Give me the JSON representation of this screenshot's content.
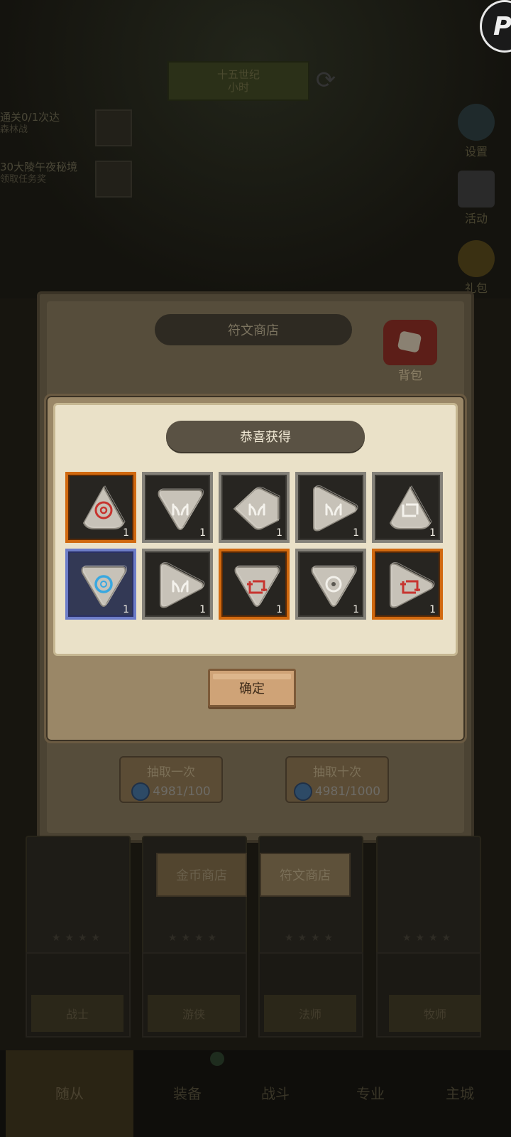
{
  "background": {
    "quest_banner": [
      "十五世纪",
      "小时"
    ],
    "tasks": [
      {
        "title": "通关0/1次达",
        "sub": "森林战"
      },
      {
        "title": "30大陵午夜秘境",
        "sub": "领取任务奖"
      }
    ],
    "side_buttons": [
      "设置",
      "活动",
      "礼包"
    ],
    "top_right_badge": "P"
  },
  "shop": {
    "title": "符文商店",
    "backpack_label": "背包",
    "draw_once": {
      "label": "抽取一次",
      "cost": "4981/100"
    },
    "draw_ten": {
      "label": "抽取十次",
      "cost": "4981/1000"
    },
    "tabs": [
      "金币商店",
      "符文商店"
    ]
  },
  "heroes": {
    "stars": "★★★★",
    "names": [
      "战士",
      "游侠",
      "法师",
      "牧师"
    ]
  },
  "bottom_nav": {
    "items": [
      "随从",
      "装备",
      "战斗",
      "专业",
      "主城"
    ]
  },
  "reward": {
    "title": "恭喜获得",
    "items": [
      {
        "rarity": "orange",
        "shape": "triangle",
        "glyph": "circle-red",
        "count": "1"
      },
      {
        "rarity": "grey",
        "shape": "shield",
        "glyph": "fork",
        "count": "1"
      },
      {
        "rarity": "grey",
        "shape": "diamond",
        "glyph": "fork",
        "count": "1"
      },
      {
        "rarity": "grey",
        "shape": "kite",
        "glyph": "fork",
        "count": "1"
      },
      {
        "rarity": "grey",
        "shape": "triangle",
        "glyph": "square",
        "count": "1"
      },
      {
        "rarity": "blue",
        "shape": "shield",
        "glyph": "circle-blue",
        "count": "1"
      },
      {
        "rarity": "grey",
        "shape": "kite",
        "glyph": "fork",
        "count": "1"
      },
      {
        "rarity": "orange",
        "shape": "shield",
        "glyph": "square-red",
        "count": "1"
      },
      {
        "rarity": "grey",
        "shape": "shield",
        "glyph": "circle-grey",
        "count": "1"
      },
      {
        "rarity": "orange",
        "shape": "kite",
        "glyph": "square-red",
        "count": "1"
      }
    ],
    "confirm_label": "确定"
  },
  "colors": {
    "orange_frame": "#d1690f",
    "blue_frame": "#6d7dc8",
    "grey_frame": "#85827a",
    "parchment": "#eae1c8",
    "title_pill": "#5a5244"
  }
}
